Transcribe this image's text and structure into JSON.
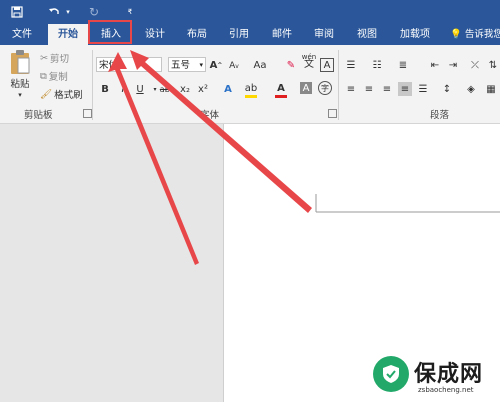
{
  "quick_access": {
    "save_icon": "save-icon",
    "undo_icon": "undo-icon",
    "redo_icon": "redo-icon"
  },
  "tabs": [
    {
      "label": "文件"
    },
    {
      "label": "开始"
    },
    {
      "label": "插入"
    },
    {
      "label": "设计"
    },
    {
      "label": "布局"
    },
    {
      "label": "引用"
    },
    {
      "label": "邮件"
    },
    {
      "label": "审阅"
    },
    {
      "label": "视图"
    },
    {
      "label": "加载项"
    }
  ],
  "tell_me": "告诉我您",
  "clipboard": {
    "paste": "粘贴",
    "cut": "剪切",
    "copy": "复制",
    "format_painter": "格式刷",
    "group_label": "剪贴板"
  },
  "font": {
    "font_name": "宋体",
    "font_size": "五号",
    "grow": "A",
    "shrink": "A",
    "change_case": "Aa",
    "phonetic": "wén",
    "phonetic_char": "文",
    "enclose": "A",
    "bold": "B",
    "italic": "I",
    "underline": "U",
    "strikethrough": "abc",
    "subscript": "x₂",
    "superscript": "x²",
    "text_effects": "A",
    "highlight": "ab",
    "font_color": "A",
    "char_shading": "A",
    "enclosed_char": "字",
    "group_label": "字体",
    "colors": {
      "font_color": "#e02020",
      "highlight": "#ffd800"
    }
  },
  "paragraph": {
    "group_label": "段落"
  },
  "accent_colors": {
    "ribbon_blue": "#2b579a",
    "annotation_red": "#e8474a"
  },
  "watermark": {
    "title": "保成网",
    "url": "zsbaocheng.net"
  }
}
